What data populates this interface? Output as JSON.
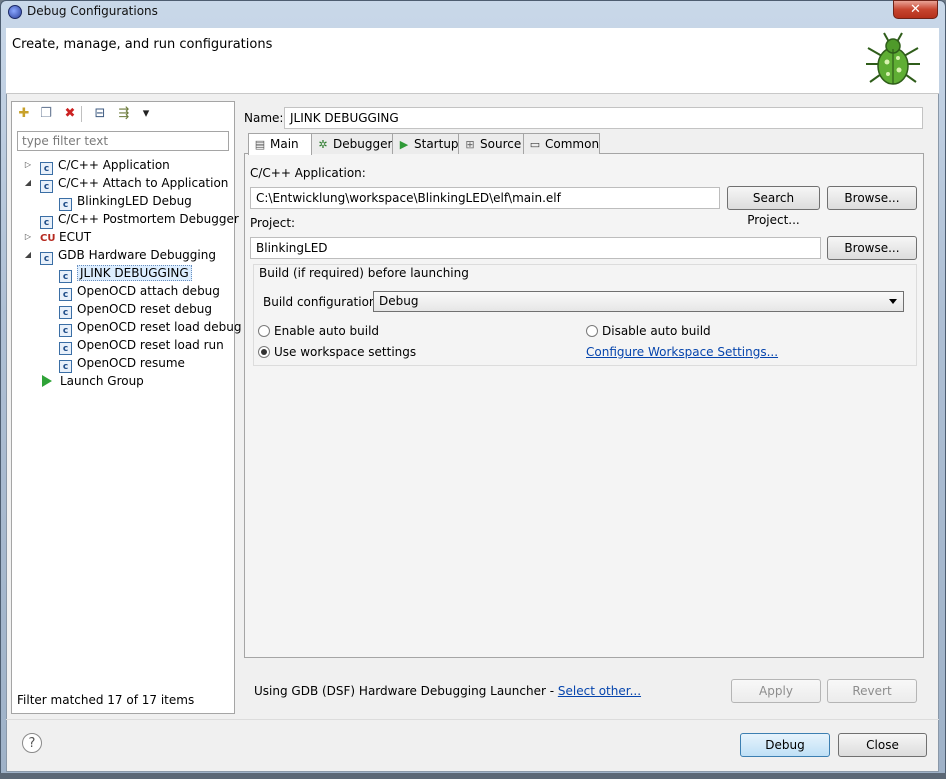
{
  "window": {
    "title": "Debug Configurations",
    "close_symbol": "✕"
  },
  "header": {
    "title": "Create, manage, and run configurations"
  },
  "left": {
    "toolbar": [
      {
        "name": "new-launch-configuration-icon",
        "glyph": "✚"
      },
      {
        "name": "duplicate-icon",
        "glyph": "❐"
      },
      {
        "name": "delete-icon",
        "glyph": "✖"
      },
      {
        "name": "collapse-all-icon",
        "glyph": "⊟"
      },
      {
        "name": "filter-icon",
        "glyph": "⇶"
      },
      {
        "name": "chevron-down-icon",
        "glyph": "▾"
      }
    ],
    "filter_placeholder": "type filter text",
    "tree": [
      {
        "label": "C/C++ Application",
        "level": 0,
        "twisty": "▷",
        "icon": "c"
      },
      {
        "label": "C/C++ Attach to Application",
        "level": 0,
        "twisty": "◢",
        "icon": "c"
      },
      {
        "label": "BlinkingLED Debug",
        "level": 1,
        "twisty": "",
        "icon": "c"
      },
      {
        "label": "C/C++ Postmortem Debugger",
        "level": 0,
        "twisty": "",
        "icon": "c"
      },
      {
        "label": "ECUT",
        "level": 0,
        "twisty": "▷",
        "icon": "cu"
      },
      {
        "label": "GDB Hardware Debugging",
        "level": 0,
        "twisty": "◢",
        "icon": "c"
      },
      {
        "label": "JLINK DEBUGGING",
        "level": 1,
        "twisty": "",
        "icon": "c",
        "selected": true
      },
      {
        "label": "OpenOCD attach debug",
        "level": 1,
        "twisty": "",
        "icon": "c"
      },
      {
        "label": "OpenOCD reset debug",
        "level": 1,
        "twisty": "",
        "icon": "c"
      },
      {
        "label": "OpenOCD reset load debug",
        "level": 1,
        "twisty": "",
        "icon": "c"
      },
      {
        "label": "OpenOCD reset load run",
        "level": 1,
        "twisty": "",
        "icon": "c"
      },
      {
        "label": "OpenOCD resume",
        "level": 1,
        "twisty": "",
        "icon": "c"
      },
      {
        "label": "Launch Group",
        "level": 0,
        "twisty": "",
        "icon": "launch"
      }
    ],
    "filter_status": "Filter matched 17 of 17 items"
  },
  "config": {
    "name_label": "Name:",
    "name_value": "JLINK DEBUGGING",
    "tabs": [
      {
        "label": "Main",
        "icon": "main-tab-icon",
        "glyph": "▤",
        "active": true
      },
      {
        "label": "Debugger",
        "icon": "debugger-bug-icon",
        "glyph": "✲",
        "active": false
      },
      {
        "label": "Startup",
        "icon": "startup-play-icon",
        "glyph": "▶",
        "active": false
      },
      {
        "label": "Source",
        "icon": "source-icon",
        "glyph": "⊞",
        "active": false
      },
      {
        "label": "Common",
        "icon": "common-icon",
        "glyph": "▭",
        "active": false
      }
    ],
    "application_label": "C/C++ Application:",
    "application_value": "C:\\Entwicklung\\workspace\\BlinkingLED\\elf\\main.elf",
    "search_project_label": "Search Project...",
    "browse_label": "Browse...",
    "project_label": "Project:",
    "project_value": "BlinkingLED",
    "build_group_label": "Build (if required) before launching",
    "build_config_label": "Build configuration:",
    "build_config_value": "Debug",
    "enable_auto_build": "Enable auto build",
    "disable_auto_build": "Disable auto build",
    "use_workspace_settings": "Use workspace settings",
    "configure_workspace_link": "Configure Workspace Settings..."
  },
  "launcher": {
    "text": "Using GDB (DSF) Hardware Debugging Launcher - ",
    "link": "Select other...",
    "apply_label": "Apply",
    "revert_label": "Revert"
  },
  "footer": {
    "help_glyph": "?",
    "debug_label": "Debug",
    "close_label": "Close"
  }
}
